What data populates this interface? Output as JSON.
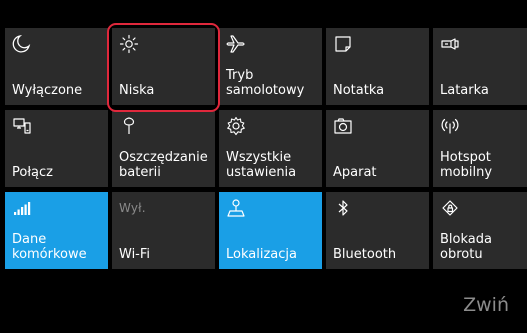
{
  "tiles": [
    {
      "label": "Wyłączone",
      "icon": "moon-icon",
      "active": false
    },
    {
      "label": "Niska",
      "icon": "brightness-sun-icon",
      "active": false
    },
    {
      "label": "Tryb\nsamolotowy",
      "icon": "airplane-icon",
      "active": false
    },
    {
      "label": "Notatka",
      "icon": "note-icon",
      "active": false
    },
    {
      "label": "Latarka",
      "icon": "flashlight-icon",
      "active": false
    },
    {
      "label": "Połącz",
      "icon": "connect-icon",
      "active": false
    },
    {
      "label": "Oszczędzanie\nbaterii",
      "icon": "battery-saver-icon",
      "active": false
    },
    {
      "label": "Wszystkie\nustawienia",
      "icon": "settings-gear-icon",
      "active": false
    },
    {
      "label": "Aparat",
      "icon": "camera-icon",
      "active": false
    },
    {
      "label": "Hotspot\nmobilny",
      "icon": "hotspot-icon",
      "active": false
    },
    {
      "label": "Dane\nkomórkowe",
      "icon": "cellular-signal-icon",
      "active": true
    },
    {
      "label": "Wi-Fi",
      "icon": "wifi-icon",
      "icon_text": "Wył.",
      "active": false
    },
    {
      "label": "Lokalizacja",
      "icon": "location-icon",
      "active": true
    },
    {
      "label": "Bluetooth",
      "icon": "bluetooth-icon",
      "active": false
    },
    {
      "label": "Blokada\nobrotu",
      "icon": "rotation-lock-icon",
      "active": false
    }
  ],
  "collapse_label": "Zwiń",
  "colors": {
    "tile": "#2b2b2b",
    "tile_active": "#1a9fe6",
    "highlight": "#e0283c",
    "background": "#000000"
  }
}
